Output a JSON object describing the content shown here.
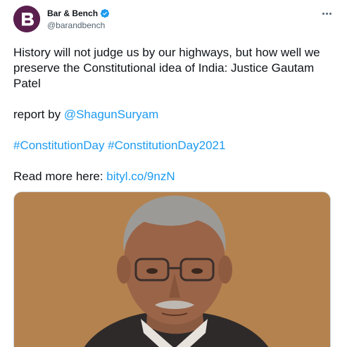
{
  "author": {
    "name": "Bar & Bench",
    "handle": "@barandbench",
    "avatar_letter": "B",
    "verified_icon": "verified-badge-icon",
    "avatar_color": "#5b1f4e",
    "verified_color": "#1d9bf0"
  },
  "menu_icon": "more-options-icon",
  "tweet": {
    "text": "History will not judge us by our highways, but how well we preserve the Constitutional idea of India: Justice Gautam Patel",
    "report_prefix": "report by ",
    "report_mention": "@ShagunSuryam",
    "hashtags": "#ConstitutionDay #ConstitutionDay2021",
    "read_more_prefix": "Read more here: ",
    "read_more_link": "bityl.co/9nzN",
    "link_color": "#1d9bf0"
  },
  "media": {
    "background_color": "#b4824f"
  }
}
